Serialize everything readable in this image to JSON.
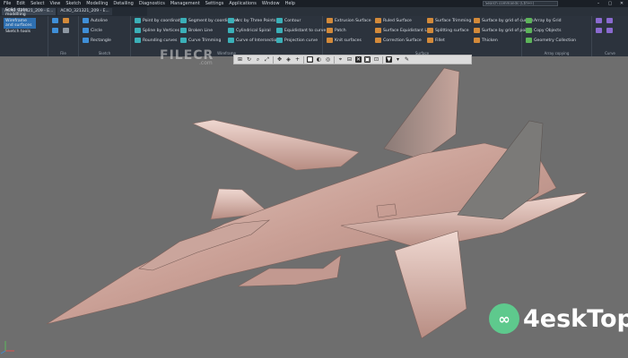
{
  "menubar": {
    "items": [
      "File",
      "Edit",
      "Select",
      "View",
      "Sketch",
      "Modelling",
      "Detailing",
      "Diagnostics",
      "Management",
      "Settings",
      "Applications",
      "Window",
      "Help"
    ],
    "search_placeholder": "Search commands (Ctrl+F)",
    "window_controls": [
      "–",
      "▢",
      "✕"
    ]
  },
  "tabs": [
    {
      "label": "ACXO_321321_209 - E...",
      "active": true
    },
    {
      "label": "ACXO_321321_209 - E...",
      "active": false
    }
  ],
  "ribbon": {
    "modes": [
      {
        "label": "Solid state modelling",
        "selected": false
      },
      {
        "label": "Wireframe and surfaces",
        "selected": true
      },
      {
        "label": "Sketch tools",
        "selected": false
      }
    ],
    "groups": {
      "file": "File",
      "sketch": "Sketch",
      "wireframe": "Wireframe",
      "surface": "Surface",
      "array": "Array copying",
      "curve": "Curve"
    },
    "sketch_buttons": [
      "Autoline",
      "Circle",
      "Rectangle"
    ],
    "wire_col1": [
      "Point by coordinates",
      "Spline by Vertices",
      "Rounding curves"
    ],
    "wire_col2": [
      "Segment by coordinates",
      "Broken Line",
      "Curve Trimming"
    ],
    "wire_col3": [
      "Arc by Three Points",
      "Cylindrical Spiral",
      "Curve of Intersection"
    ],
    "wire_col4": [
      "Contour",
      "Equidistant to curve",
      "Projection curve"
    ],
    "surf_col1": [
      "Extrusion Surface",
      "Patch",
      "Knit surfaces"
    ],
    "surf_col2": [
      "Ruled Surface",
      "Surface Equidistant Line",
      "Correction Surface"
    ],
    "surf_col3": [
      "Surface Trimming",
      "Splitting surface",
      "Fillet"
    ],
    "surf_col4": [
      "Surface by grid of curves",
      "Surface by grid of points",
      "Thicken"
    ],
    "array_buttons": [
      "Array by Grid",
      "Copy Objects",
      "Geometry Collection"
    ]
  },
  "watermark": {
    "text": "FILECR",
    "sub": ".com"
  },
  "brand": {
    "logo_glyph": "∞",
    "text": "4eskTop"
  },
  "colors": {
    "menubar": "#1a1f26",
    "ribbon": "#2c333d",
    "viewport": "#6e6e6e",
    "model": "#c9a39a",
    "brand_green": "#5ec98d"
  }
}
